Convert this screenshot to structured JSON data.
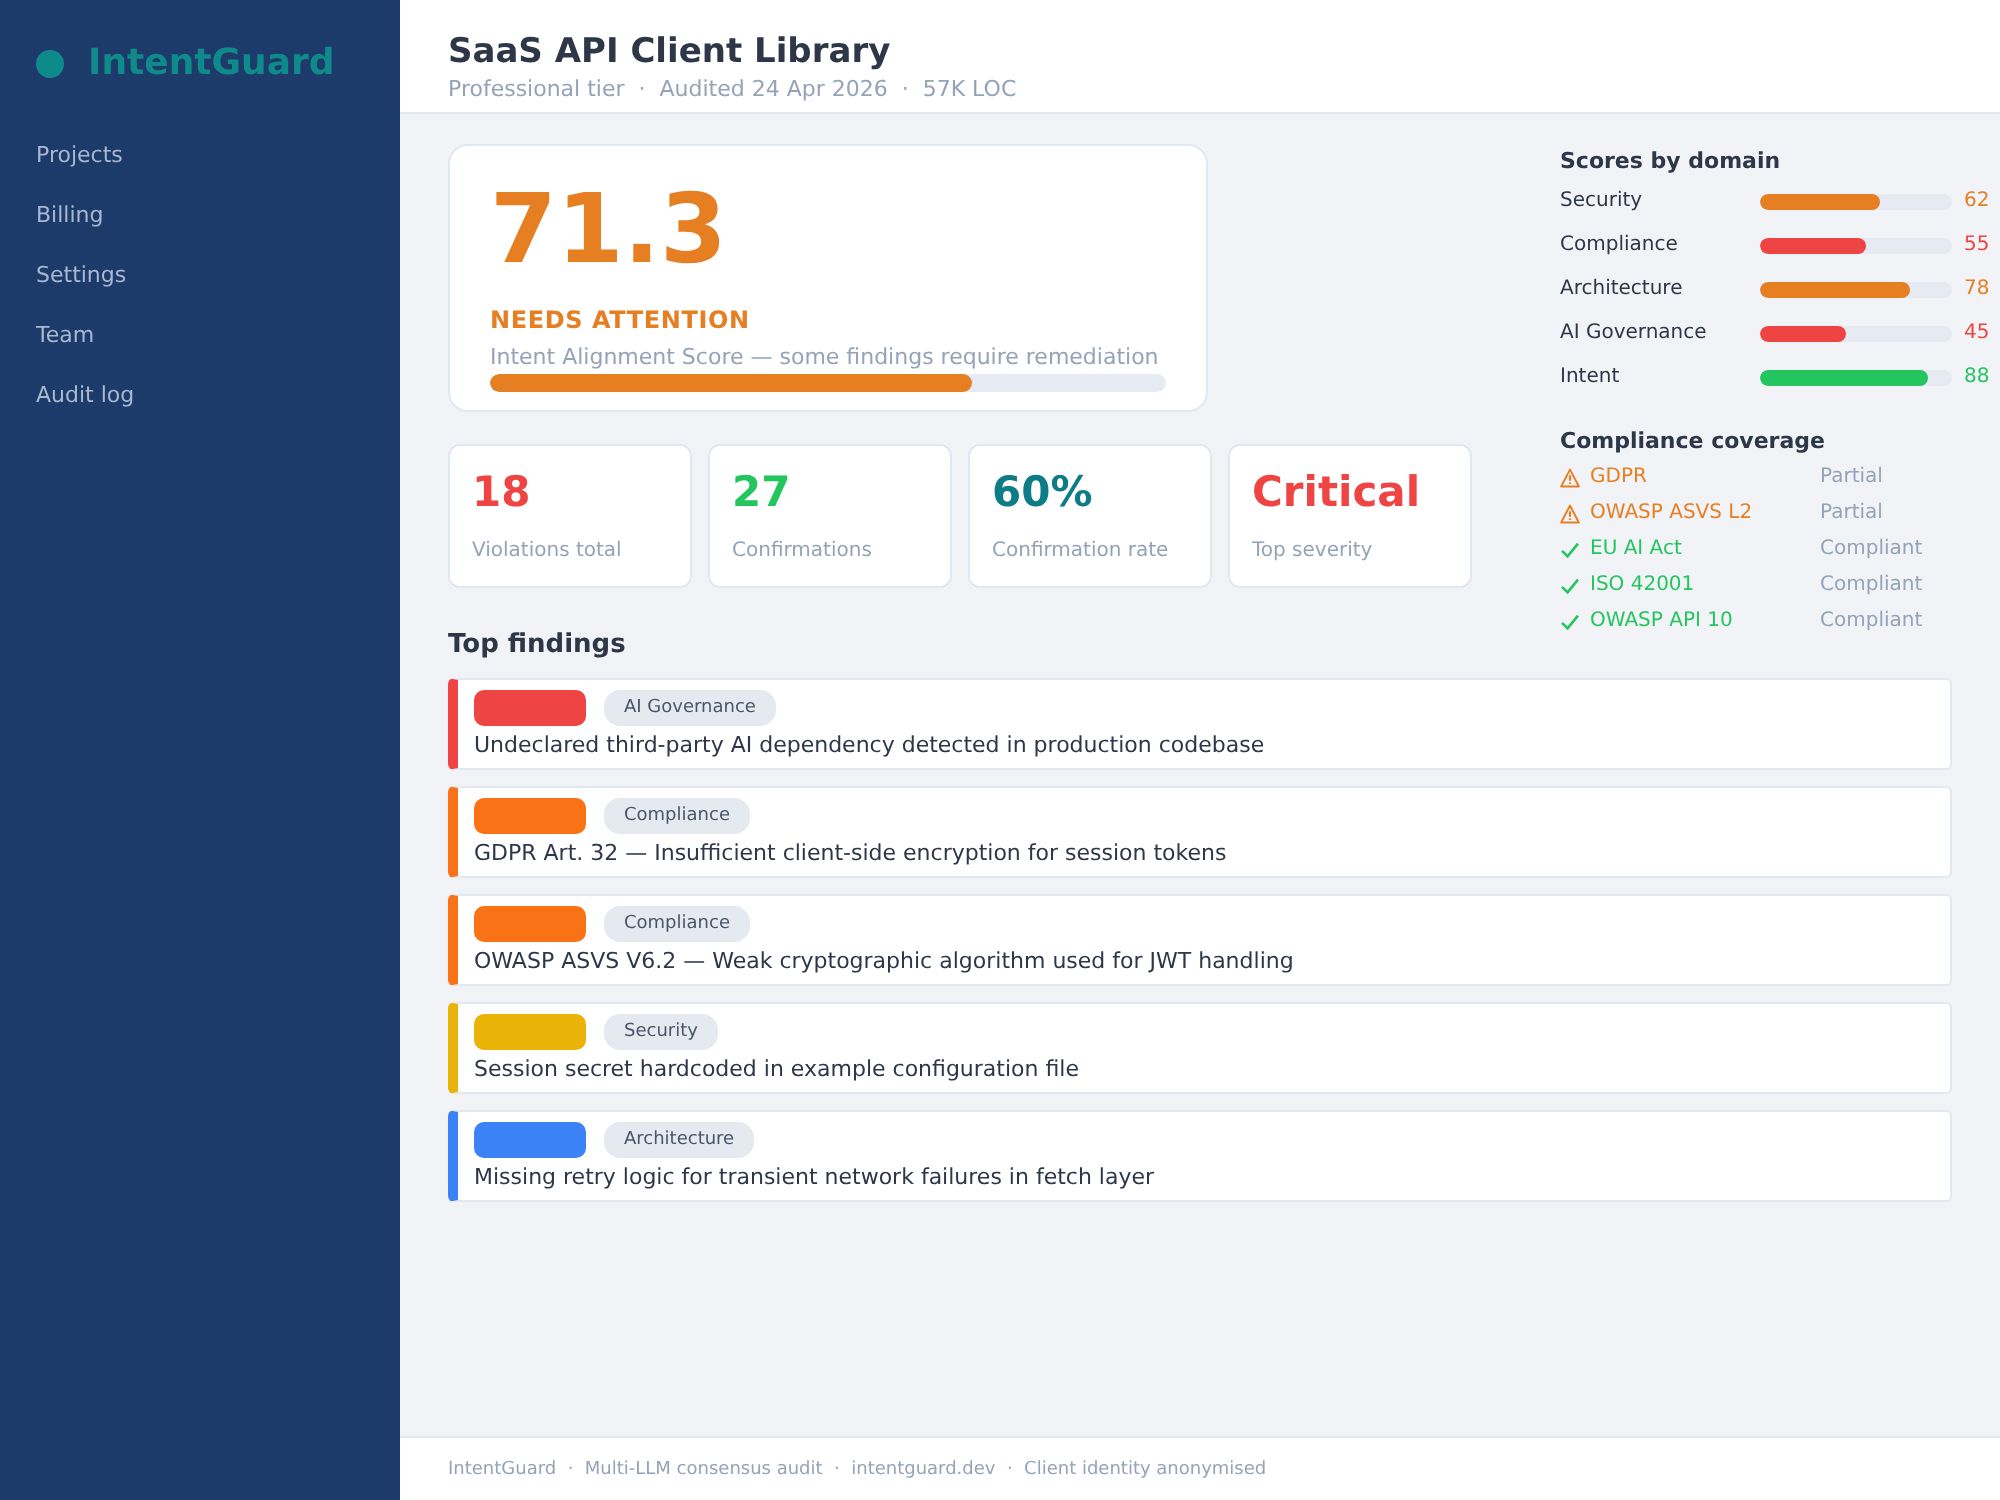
{
  "sidebar": {
    "brand": "IntentGuard",
    "items": [
      "Projects",
      "Billing",
      "Settings",
      "Team",
      "Audit log"
    ]
  },
  "header": {
    "title": "SaaS API Client Library",
    "meta": "Professional tier  ·  Audited 24 Apr 2026  ·  57K LOC"
  },
  "score_card": {
    "score": "71.3",
    "status": "NEEDS ATTENTION",
    "caption": "Intent Alignment Score — some findings require remediation",
    "level": 0.713
  },
  "metrics": [
    {
      "value": "18",
      "label": "Violations total",
      "color": "#ef4444"
    },
    {
      "value": "27",
      "label": "Confirmations",
      "color": "#22c55e"
    },
    {
      "value": "60%",
      "label": "Confirmation rate",
      "color": "#0e7c86"
    },
    {
      "value": "Critical",
      "label": "Top severity",
      "color": "#ef4444"
    }
  ],
  "domain_scores": {
    "title": "Scores by domain",
    "items": [
      {
        "name": "Security",
        "level": 0.62,
        "value": "62",
        "color": "#e67e22"
      },
      {
        "name": "Compliance",
        "level": 0.55,
        "value": "55",
        "color": "#ef4444"
      },
      {
        "name": "Architecture",
        "level": 0.78,
        "value": "78",
        "color": "#e67e22"
      },
      {
        "name": "AI Governance",
        "level": 0.45,
        "value": "45",
        "color": "#ef4444"
      },
      {
        "name": "Intent",
        "level": 0.88,
        "value": "88",
        "color": "#22c55e"
      }
    ]
  },
  "compliance": {
    "title": "Compliance coverage",
    "items": [
      {
        "kind": "warning",
        "name": "GDPR",
        "status": "Partial",
        "color": "#e67e22"
      },
      {
        "kind": "warning",
        "name": "OWASP ASVS L2",
        "status": "Partial",
        "color": "#e67e22"
      },
      {
        "kind": "check",
        "name": "EU AI Act",
        "status": "Compliant",
        "color": "#22c55e"
      },
      {
        "kind": "check",
        "name": "ISO 42001",
        "status": "Compliant",
        "color": "#22c55e"
      },
      {
        "kind": "check",
        "name": "OWASP API 10",
        "status": "Compliant",
        "color": "#22c55e"
      }
    ]
  },
  "findings": {
    "title": "Top findings",
    "items": [
      {
        "color": "#ef4444",
        "category": "AI Governance",
        "title": "Undeclared third-party AI dependency detected in production codebase"
      },
      {
        "color": "#f97316",
        "category": "Compliance",
        "title": "GDPR Art. 32 — Insufficient client-side encryption for session tokens"
      },
      {
        "color": "#f97316",
        "category": "Compliance",
        "title": "OWASP ASVS V6.2 — Weak cryptographic algorithm used for JWT handling"
      },
      {
        "color": "#eab308",
        "category": "Security",
        "title": "Session secret hardcoded in example configuration file"
      },
      {
        "color": "#3b82f6",
        "category": "Architecture",
        "title": "Missing retry logic for transient network failures in fetch layer"
      }
    ]
  },
  "footer": "IntentGuard  ·  Multi-LLM consensus audit  ·  intentguard.dev  ·  Client identity anonymised"
}
